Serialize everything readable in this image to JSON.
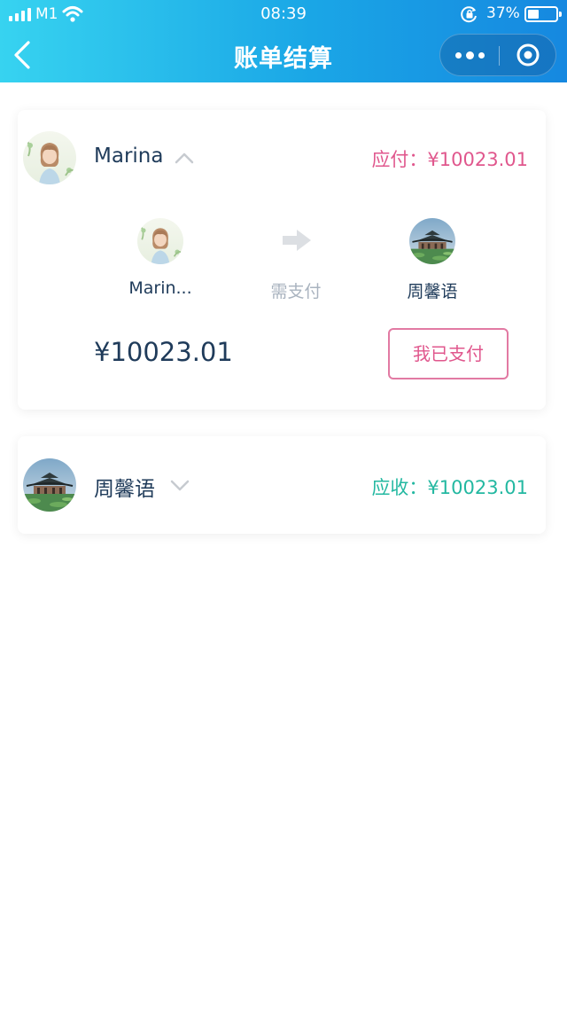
{
  "status_bar": {
    "carrier": "M1",
    "time": "08:39",
    "battery": "37%"
  },
  "nav": {
    "title": "账单结算"
  },
  "colors": {
    "header_start": "#37d3f0",
    "header_end": "#1688e0",
    "pay": "#e0578d",
    "receive": "#23b8a1"
  },
  "payer_card": {
    "name": "Marina",
    "amount_label": "应付：¥10023.01",
    "expanded": true,
    "flow": {
      "from_name": "Marin...",
      "action": "需支付",
      "to_name": "周馨语"
    },
    "amount": "¥10023.01",
    "paid_button": "我已支付"
  },
  "receiver_card": {
    "name": "周馨语",
    "amount_label": "应收：¥10023.01",
    "expanded": false
  }
}
